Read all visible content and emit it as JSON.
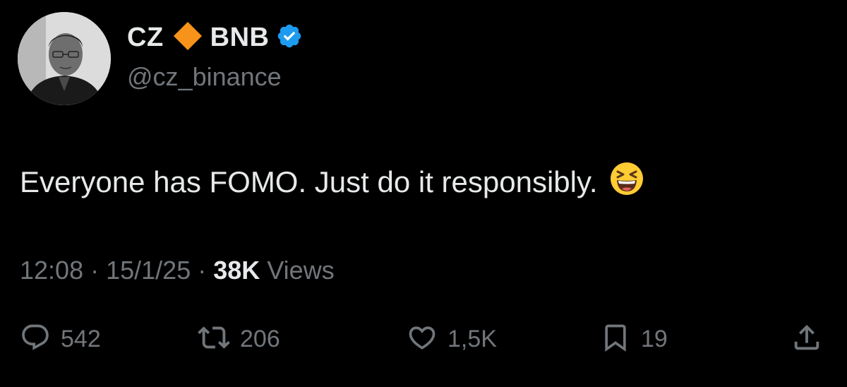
{
  "author": {
    "display_name_first": "CZ",
    "display_name_second": "BNB",
    "handle": "@cz_binance",
    "diamond_icon": "orange-diamond-icon",
    "verified_icon": "verified-badge-icon"
  },
  "tweet": {
    "text": "Everyone has FOMO. Just do it responsibly.",
    "emoji": "grinning-squinting-face-emoji"
  },
  "meta": {
    "time": "12:08",
    "separator": "·",
    "date": "15/1/25",
    "views_count": "38K",
    "views_label": "Views"
  },
  "actions": {
    "replies": "542",
    "reposts": "206",
    "likes": "1,5K",
    "bookmarks": "19"
  },
  "colors": {
    "background": "#000000",
    "primary_text": "#e7e9ea",
    "secondary_text": "#71767b",
    "verified_blue": "#1d9bf0",
    "diamond_orange": "#f7931a"
  }
}
